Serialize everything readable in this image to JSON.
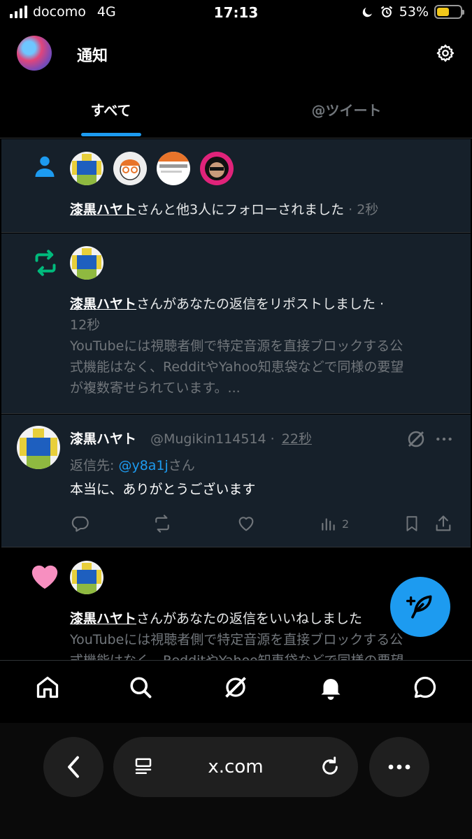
{
  "status_bar": {
    "carrier": "docomo",
    "network": "4G",
    "time": "17:13",
    "battery": "53%",
    "battery_level": 0.53
  },
  "header": {
    "title": "通知"
  },
  "tabs": [
    {
      "label": "すべて"
    },
    {
      "label": "@ツイート"
    }
  ],
  "notifications": {
    "follow": {
      "user": "漆黒ハヤト",
      "text": "さんと他3人にフォローされました",
      "time": "· 2秒"
    },
    "repost": {
      "user": "漆黒ハヤト",
      "text": "さんがあなたの返信をリポストしました ·",
      "time": "12秒",
      "preview_line1": "YouTubeには視聴者側で特定音源を直接ブロックする公",
      "preview_line2": "式機能はなく、RedditやYahoo知恵袋などで同様の要望",
      "preview_line3": "が複数寄せられています。..."
    },
    "reply": {
      "name": "漆黒ハヤト",
      "handle": "@Mugikin114514 ·",
      "time": "22秒",
      "reply_to_prefix": "返信先: ",
      "reply_to_user": "@y8a1j",
      "reply_to_suffix": "さん",
      "body": "本当に、ありがとうございます",
      "views": "2"
    },
    "like": {
      "user": "漆黒ハヤト",
      "text": "さんがあなたの返信をいいねしました",
      "preview_line1": "YouTubeには視聴者側で特定音源を直接ブロックする公",
      "preview_line2": "式機能はなく、RedditやYahoo知恵袋などで同様の要望"
    }
  },
  "browser": {
    "url": "x.com"
  },
  "colors": {
    "accent": "#1d9bf0",
    "repost_green": "#00ba7c",
    "like_pink": "#f91880"
  }
}
